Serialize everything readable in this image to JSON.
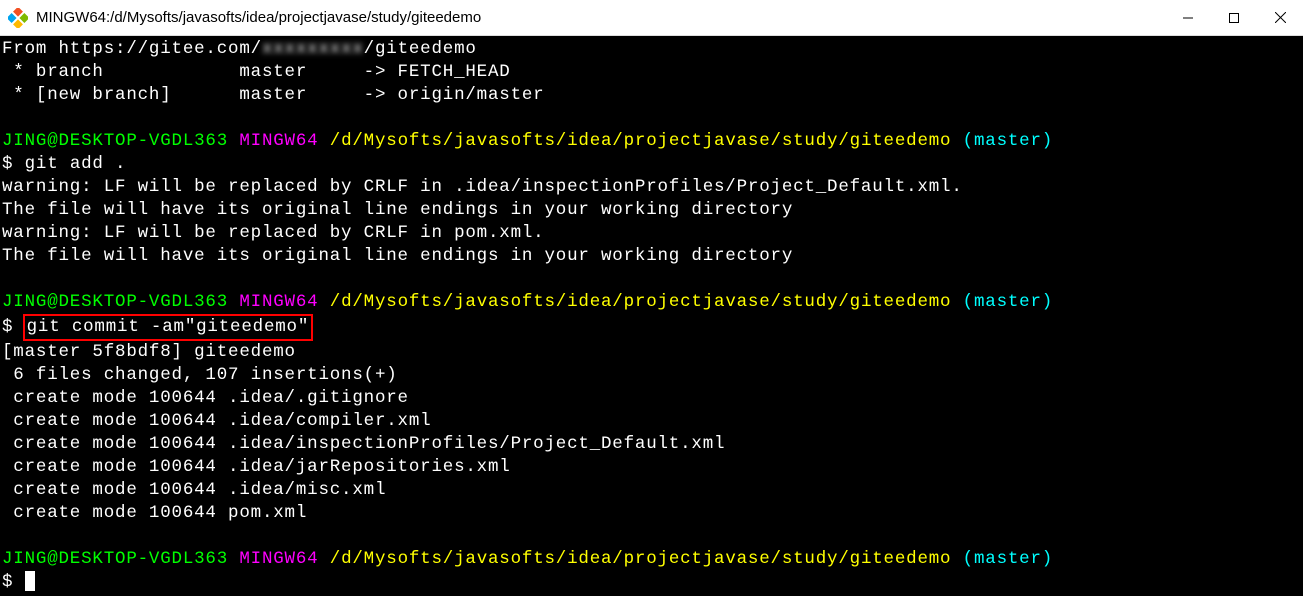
{
  "window": {
    "title": "MINGW64:/d/Mysofts/javasofts/idea/projectjavase/study/giteedemo"
  },
  "terminal": {
    "fetch_line1": "From https://gitee.com/",
    "fetch_line1_blur": "xxxxxxxxx",
    "fetch_line1_end": "/giteedemo",
    "fetch_line2": " * branch            master     -> FETCH_HEAD",
    "fetch_line3": " * [new branch]      master     -> origin/master",
    "prompt1_user": "JING@DESKTOP-VGDL363",
    "prompt1_env": " MINGW64 ",
    "prompt1_path": "/d/Mysofts/javasofts/idea/projectjavase/study/giteedemo",
    "prompt1_branch": " (master)",
    "cmd1_prompt": "$ ",
    "cmd1": "git add .",
    "warn1": "warning: LF will be replaced by CRLF in .idea/inspectionProfiles/Project_Default.xml.",
    "warn2": "The file will have its original line endings in your working directory",
    "warn3": "warning: LF will be replaced by CRLF in pom.xml.",
    "warn4": "The file will have its original line endings in your working directory",
    "prompt2_user": "JING@DESKTOP-VGDL363",
    "prompt2_env": " MINGW64 ",
    "prompt2_path": "/d/Mysofts/javasofts/idea/projectjavase/study/giteedemo",
    "prompt2_branch": " (master)",
    "cmd2_prompt": "$ ",
    "cmd2": "git commit -am\"giteedemo\"",
    "commit1": "[master 5f8bdf8] giteedemo",
    "commit2": " 6 files changed, 107 insertions(+)",
    "commit3": " create mode 100644 .idea/.gitignore",
    "commit4": " create mode 100644 .idea/compiler.xml",
    "commit5": " create mode 100644 .idea/inspectionProfiles/Project_Default.xml",
    "commit6": " create mode 100644 .idea/jarRepositories.xml",
    "commit7": " create mode 100644 .idea/misc.xml",
    "commit8": " create mode 100644 pom.xml",
    "prompt3_user": "JING@DESKTOP-VGDL363",
    "prompt3_env": " MINGW64 ",
    "prompt3_path": "/d/Mysofts/javasofts/idea/projectjavase/study/giteedemo",
    "prompt3_branch": " (master)",
    "cmd3_prompt": "$ "
  }
}
